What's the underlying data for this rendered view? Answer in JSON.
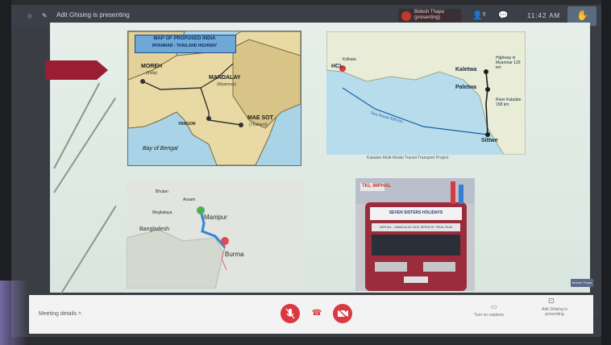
{
  "topbar": {
    "presenting_text": "Adit Ghising is presenting",
    "presenter_name": "Bidesh Thapa (presenting)",
    "time": "11:42 AM"
  },
  "slide": {
    "map1": {
      "title": "MAP OF PROPOSED INDIA",
      "subtitle": "MYANMAR - THAILAND HIGHWAY",
      "labels": {
        "moreh": "MOREH",
        "moreh_sub": "(India)",
        "mandalay": "MANDALAY",
        "mandalay_sub": "(Myanmar)",
        "yangon": "YANGON",
        "mae_sot": "MAE SOT",
        "mae_sot_sub": "(Thailand)",
        "bay": "Bay of Bengal"
      }
    },
    "map2": {
      "caption": "Kaladan Multi-Modal Transit Transport Project",
      "labels": {
        "kolkata": "Kolkata",
        "hcl": "HCL",
        "kaletwa": "Kaletwa",
        "paletwa": "Paletwa",
        "sittwe": "Sittwe",
        "sea_route": "Sea Route 539 km",
        "highway": "Highway in Myanmar 129 km",
        "river": "River Kaladan 158 km"
      }
    },
    "map3": {
      "labels": {
        "manipur": "Manipur",
        "burma": "Burma",
        "bangladesh": "Bangladesh",
        "meghalaya": "Meghalaya",
        "bhutan": "Bhutan",
        "assam": "Assam"
      }
    },
    "photo": {
      "top_text": "TKL IMPHAL",
      "banner_text": "SEVEN SISTERS HOLIDAYS",
      "banner_sub": "IMPHAL - MANDALAY BUS SERVICE TRIAL RUN"
    }
  },
  "bottombar": {
    "meeting_details": "Meeting details",
    "captions_label": "Turn on captions",
    "present_label": "Adit Ghising is presenting"
  },
  "edge_label": "Bidesh Thapa",
  "colors": {
    "accent_red": "#d93a3f",
    "slide_arrow": "#9a1d32"
  }
}
